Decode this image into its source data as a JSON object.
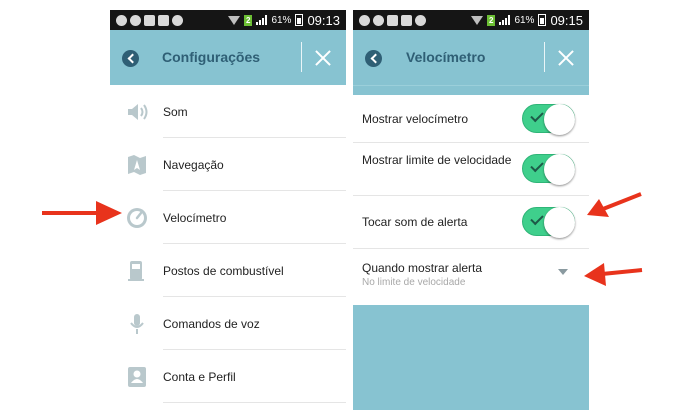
{
  "left_screen": {
    "status_bar": {
      "battery_pct": "61%",
      "time": "09:13",
      "badge": "2"
    },
    "header": {
      "title": "Configurações"
    },
    "menu_items": [
      {
        "label": "Som",
        "icon": "speaker-icon"
      },
      {
        "label": "Navegação",
        "icon": "map-icon"
      },
      {
        "label": "Velocímetro",
        "icon": "speedometer-icon"
      },
      {
        "label": "Postos de combustível",
        "icon": "fuel-pump-icon"
      },
      {
        "label": "Comandos de voz",
        "icon": "microphone-icon"
      },
      {
        "label": "Conta e Perfil",
        "icon": "profile-card-icon"
      }
    ]
  },
  "right_screen": {
    "status_bar": {
      "battery_pct": "61%",
      "time": "09:15",
      "badge": "2"
    },
    "header": {
      "title": "Velocímetro"
    },
    "settings": [
      {
        "label": "Mostrar velocímetro",
        "enabled": true
      },
      {
        "label": "Mostrar limite de velocidade",
        "enabled": true
      },
      {
        "label": "Tocar som de alerta",
        "enabled": true
      }
    ],
    "alert_option": {
      "label": "Quando mostrar alerta",
      "value": "No limite de velocidade"
    }
  },
  "colors": {
    "header_bg": "#87c3d1",
    "header_text": "#2f5f75",
    "toggle_on": "#3fcf8c",
    "annotation_arrow": "#e8331c"
  }
}
